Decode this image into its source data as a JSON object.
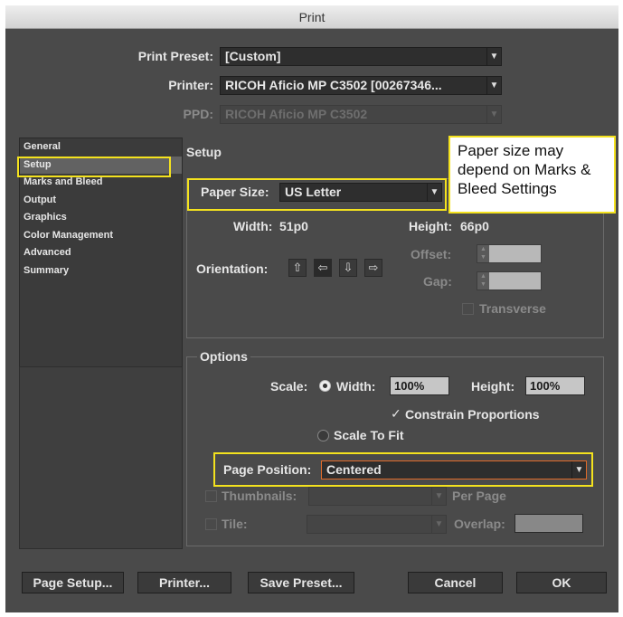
{
  "window": {
    "title": "Print"
  },
  "top": {
    "print_preset_label": "Print Preset:",
    "print_preset_value": "[Custom]",
    "printer_label": "Printer:",
    "printer_value": "RICOH Aficio MP C3502 [00267346...",
    "ppd_label": "PPD:",
    "ppd_value": "RICOH Aficio MP C3502"
  },
  "sidebar": {
    "items": [
      {
        "label": "General"
      },
      {
        "label": "Setup"
      },
      {
        "label": "Marks and Bleed"
      },
      {
        "label": "Output"
      },
      {
        "label": "Graphics"
      },
      {
        "label": "Color Management"
      },
      {
        "label": "Advanced"
      },
      {
        "label": "Summary"
      }
    ],
    "selected": "Setup"
  },
  "setup": {
    "title": "Setup",
    "paper_size_label": "Paper Size:",
    "paper_size_value": "US Letter",
    "width_label": "Width:",
    "width_value": "51p0",
    "height_label": "Height:",
    "height_value": "66p0",
    "orientation_label": "Orientation:",
    "offset_label": "Offset:",
    "gap_label": "Gap:",
    "transverse_label": "Transverse"
  },
  "options": {
    "title": "Options",
    "scale_label": "Scale:",
    "scale_width_label": "Width:",
    "scale_width_value": "100%",
    "scale_height_label": "Height:",
    "scale_height_value": "100%",
    "constrain_label": "Constrain Proportions",
    "scale_to_fit_label": "Scale To Fit",
    "page_position_label": "Page Position:",
    "page_position_value": "Centered",
    "thumbnails_label": "Thumbnails:",
    "per_page_label": "Per Page",
    "tile_label": "Tile:",
    "overlap_label": "Overlap:"
  },
  "callout": {
    "text": "Paper size may depend on Marks & Bleed Settings"
  },
  "buttons": {
    "page_setup": "Page Setup...",
    "printer": "Printer...",
    "save_preset": "Save Preset...",
    "cancel": "Cancel",
    "ok": "OK"
  },
  "colors": {
    "panel": "#4a4a4a",
    "highlight": "#f4e21e",
    "selected_nav": "#626262"
  }
}
